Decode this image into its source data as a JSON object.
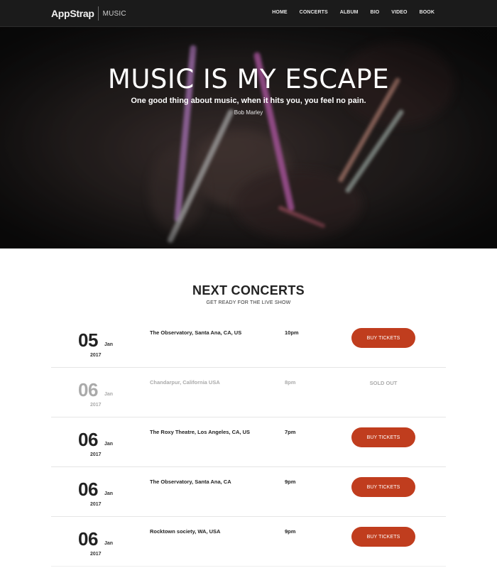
{
  "navbar": {
    "brand": "AppStrap",
    "brand_sub": "MUSIC",
    "links": [
      "HOME",
      "CONCERTS",
      "ALBUM",
      "BIO",
      "VIDEO",
      "BOOK"
    ]
  },
  "hero": {
    "title": "MUSIC IS MY ESCAPE",
    "quote": "One good thing about music, when it hits you, you feel no pain.",
    "author": "Bob Marley"
  },
  "concerts": {
    "title": "NEXT CONCERTS",
    "subtitle": "GET READY FOR THE LIVE SHOW",
    "items": [
      {
        "day": "05",
        "month": "Jan",
        "year": "2017",
        "venue": "The Observatory, Santa Ana, CA, US",
        "time": "10pm",
        "action": "BUY TICKETS"
      },
      {
        "day": "06",
        "month": "Jan",
        "year": "2017",
        "venue": "Chandarpur, California USA",
        "time": "8pm",
        "action": "SOLD OUT"
      },
      {
        "day": "06",
        "month": "Jan",
        "year": "2017",
        "venue": "The Roxy Theatre, Los Angeles, CA, US",
        "time": "7pm",
        "action": "BUY TICKETS"
      },
      {
        "day": "06",
        "month": "Jan",
        "year": "2017",
        "venue": "The Observatory, Santa Ana, CA",
        "time": "9pm",
        "action": "BUY TICKETS"
      },
      {
        "day": "06",
        "month": "Jan",
        "year": "2017",
        "venue": "Rocktown society, WA, USA",
        "time": "9pm",
        "action": "BUY TICKETS"
      }
    ]
  },
  "colors": {
    "accent": "#c03d1e",
    "navbar_bg": "#1b1b1b",
    "muted_text": "#aaaaaa"
  }
}
